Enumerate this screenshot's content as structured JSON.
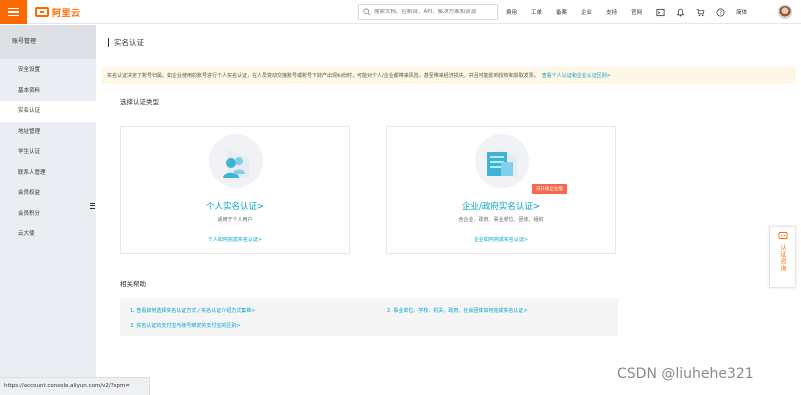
{
  "topbar": {
    "logo_text": "阿里云",
    "search_placeholder": "搜索文档、控制台、API、解决方案和资源",
    "nav_items": [
      "费用",
      "工单",
      "备案",
      "企业",
      "支持",
      "官网"
    ],
    "language": "简体",
    "icons": [
      "terminal-icon",
      "bell-icon",
      "cart-icon",
      "help-icon"
    ],
    "accent_color": "#ff6a00"
  },
  "sidebar": {
    "title": "账号管理",
    "items": [
      {
        "label": "安全设置"
      },
      {
        "label": "基本资料"
      },
      {
        "label": "实名认证"
      },
      {
        "label": "地址管理"
      },
      {
        "label": "学生认证"
      },
      {
        "label": "联系人管理"
      },
      {
        "label": "会员权益"
      },
      {
        "label": "会员积分"
      },
      {
        "label": "云大使"
      }
    ],
    "active_index": 2
  },
  "main": {
    "page_title": "实名认证",
    "notice_text": "实名认证决定了账号归属。如企业使用的账号进行个人实名认证，在人员变动交接账号或账号下财产出现纠纷时，可能对个人/企业都带来风险，甚至带来经济损失，并且可能影响授权和获取发票。",
    "notice_link": "查看个人认证和企业认证区别>",
    "select_type_label": "选择认证类型",
    "cards": [
      {
        "title": "个人实名认证>",
        "subtitle": "适用于个人用户",
        "link": "个人如何完成实名认证>"
      },
      {
        "title": "企业/政府实名认证>",
        "subtitle": "含企业、政府、事业单位、团体、组织",
        "link": "企业如何完成实名认证>",
        "badge": "可升级企业版"
      }
    ],
    "help_label": "相关帮助",
    "help_links": [
      "1. 查看如何选择实名认证方式 / 实名认证介绍方式集锦>",
      "2. 事业单位、学校、机关、政府、社会团体如何完成实名认证>",
      "3. 实名认证的支付宝与账号绑定的支付宝的区别>"
    ]
  },
  "float_tab": {
    "label": "认证咨询"
  },
  "status_url": "https://account.console.aliyun.com/v2/?spm=",
  "watermark": "CSDN @liuhehe321"
}
